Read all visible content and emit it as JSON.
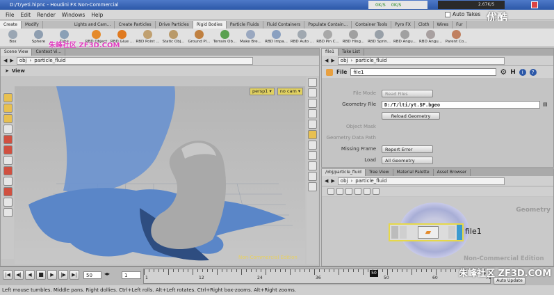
{
  "window_title": "D:/T/yeti.hipnc - Houdini FX Non-Commercial",
  "net_speed": {
    "down": "0K/S",
    "up": "0K/S",
    "rate": "2.67K/S"
  },
  "menu": [
    "File",
    "Edit",
    "Render",
    "Windows",
    "Help"
  ],
  "auto_takes": "Auto Takes",
  "shelf_tabs": [
    "Create",
    "Modify",
    "Lights and Cam...",
    "Create Particles",
    "Drive Particles",
    "Rigid Bodies",
    "Particle Fluids",
    "Fluid Containers",
    "Populate Contain...",
    "Container Tools",
    "Pyro FX",
    "Cloth",
    "Wires",
    "Fur"
  ],
  "shelf_tools_left": [
    {
      "label": "Box",
      "color": "#9aa6b3"
    },
    {
      "label": "Sphere",
      "color": "#8e9eb0"
    },
    {
      "label": "Tube",
      "color": "#8aa0b6"
    }
  ],
  "shelf_tools_right": [
    {
      "label": "RBD Object",
      "color": "#e58a2a"
    },
    {
      "label": "RBD Glue ...",
      "color": "#e07a20"
    },
    {
      "label": "RBD Point ...",
      "color": "#c0a070"
    },
    {
      "label": "Static Obj...",
      "color": "#b99a6a"
    },
    {
      "label": "Ground Pl...",
      "color": "#c08040"
    },
    {
      "label": "Terrain Ob...",
      "color": "#5aa050"
    },
    {
      "label": "Make Bre...",
      "color": "#9aa8c0"
    },
    {
      "label": "RBD Impa...",
      "color": "#8aa0c0"
    },
    {
      "label": "RBD Auto ...",
      "color": "#a0a8b0"
    },
    {
      "label": "RBD Pin C...",
      "color": "#a8a8a8"
    },
    {
      "label": "RBD Hing...",
      "color": "#a0a0a0"
    },
    {
      "label": "RBD Sprin...",
      "color": "#98a0a8"
    },
    {
      "label": "RBD Angu...",
      "color": "#a0a0a0"
    },
    {
      "label": "RBD Angu...",
      "color": "#a8a0a0"
    },
    {
      "label": "Parent Co...",
      "color": "#c08060"
    }
  ],
  "watermark_top": "朱峰社区 ZF3D.COM",
  "scene_tabs": [
    "Scene View",
    "Context Vi..."
  ],
  "path": {
    "obj": "obj",
    "node": "particle_fluid"
  },
  "view_label": "View",
  "persp_label": "persp1",
  "cam_label": "no cam",
  "noncommercial_viewport": "Non-Commercial Edition",
  "param_tabs": [
    "file1",
    "Take List"
  ],
  "file_node": {
    "type_label": "File",
    "name": "file1",
    "file_mode_label": "File Mode",
    "file_mode_value": "Read Files",
    "geometry_file_label": "Geometry File",
    "geometry_file_value": "D:/T/lti/yt.$F.bgeo",
    "reload_label": "Reload Geometry",
    "object_mask_label": "Object Mask",
    "geometry_data_path_label": "Geometry Data Path",
    "missing_frame_label": "Missing Frame",
    "missing_frame_value": "Report Error",
    "load_label": "Load",
    "load_value": "All Geometry"
  },
  "network_tabs": [
    "/obj/particle_fluid",
    "Tree View",
    "Material Palette",
    "Asset Browser"
  ],
  "network": {
    "context_label": "Geometry",
    "node_name": "file1",
    "noncommercial": "Non-Commercial Edition"
  },
  "timeline": {
    "frame": "50",
    "start": "1",
    "current_marker": "50",
    "end_marker": "71",
    "ticks": [
      "1",
      "12",
      "24",
      "36",
      "50",
      "60",
      "71"
    ],
    "auto_update": "Auto Update"
  },
  "watermark_bottom": "朱峰社区 ZF3D.COM",
  "logo_text": "优酷",
  "status_text": "Left mouse tumbles. Middle pans. Right dollies. Ctrl+Left rolls. Alt+Left rotates. Ctrl+Right box-zooms. Alt+Right zooms.",
  "colors": {
    "accent": "#2c58a8",
    "fluid": "#5a86c8",
    "viewport_bg": "#bcbcbc",
    "network_ring": "#9aa2c8"
  }
}
